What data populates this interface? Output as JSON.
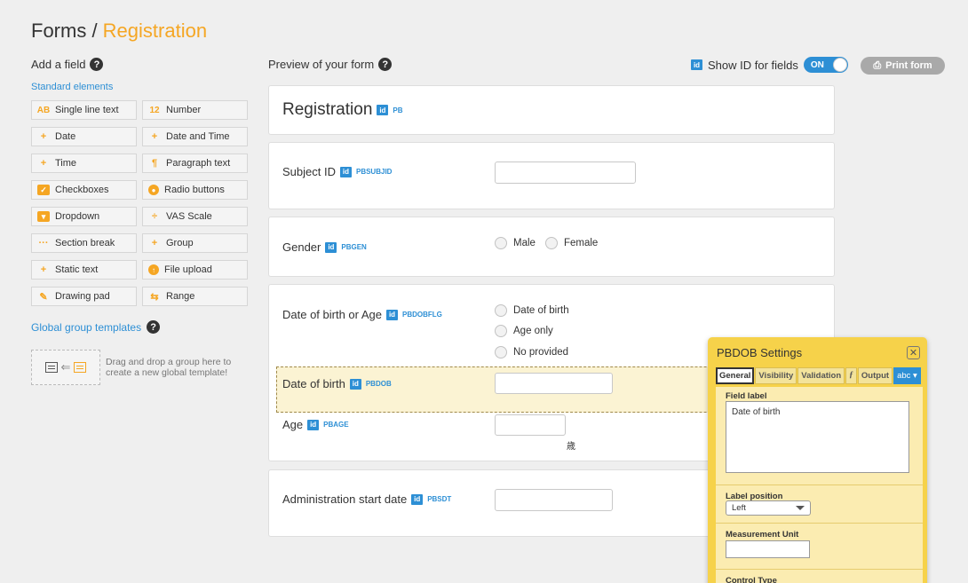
{
  "header": {
    "title_prefix": "Forms / ",
    "title_accent": "Registration"
  },
  "left": {
    "add_field": "Add a field",
    "standard_elements": "Standard elements",
    "tiles": [
      {
        "icon": "AB",
        "label": "Single line text"
      },
      {
        "icon": "12",
        "label": "Number"
      },
      {
        "icon": "+",
        "label": "Date"
      },
      {
        "icon": "+",
        "label": "Date and Time"
      },
      {
        "icon": "+",
        "label": "Time"
      },
      {
        "icon": "¶",
        "label": "Paragraph text"
      },
      {
        "icon": "✓",
        "label": "Checkboxes"
      },
      {
        "icon": "●",
        "label": "Radio buttons"
      },
      {
        "icon": "▾",
        "label": "Dropdown"
      },
      {
        "icon": "÷",
        "label": "VAS Scale"
      },
      {
        "icon": "···",
        "label": "Section break"
      },
      {
        "icon": "+",
        "label": "Group"
      },
      {
        "icon": "+",
        "label": "Static text"
      },
      {
        "icon": "↑",
        "label": "File upload"
      },
      {
        "icon": "✎",
        "label": "Drawing pad"
      },
      {
        "icon": "⇆",
        "label": "Range"
      }
    ],
    "global_templates": "Global group templates",
    "drop_line1": "Drag and drop a group here to",
    "drop_line2": "create a new global template!"
  },
  "preview": {
    "label": "Preview of your form",
    "show_id": "Show ID for fields",
    "toggle": "ON",
    "print": "Print form",
    "id_badge": "id"
  },
  "form": {
    "title": "Registration",
    "title_id": "PB",
    "subject_label": "Subject ID",
    "subject_id": "PBSUBJID",
    "gender_label": "Gender",
    "gender_id": "PBGEN",
    "gender_options": [
      "Male",
      "Female"
    ],
    "dobflg_label": "Date of birth or Age",
    "dobflg_id": "PBDOBFLG",
    "dobflg_options": [
      "Date of birth",
      "Age only",
      "No provided"
    ],
    "dob_label": "Date of birth",
    "dob_id": "PBDOB",
    "age_label": "Age",
    "age_id": "PBAGE",
    "age_unit": "歳",
    "admin_label": "Administration start date",
    "admin_id": "PBSDT"
  },
  "settings": {
    "title": "PBDOB Settings",
    "tabs": [
      "General",
      "Visibility",
      "Validation",
      "ƒ",
      "Output",
      "abc ▾"
    ],
    "field_label_title": "Field label",
    "field_label_value": "Date of birth",
    "label_position_title": "Label position",
    "label_position_value": "Left",
    "measurement_unit_title": "Measurement Unit",
    "control_type_title": "Control Type"
  }
}
